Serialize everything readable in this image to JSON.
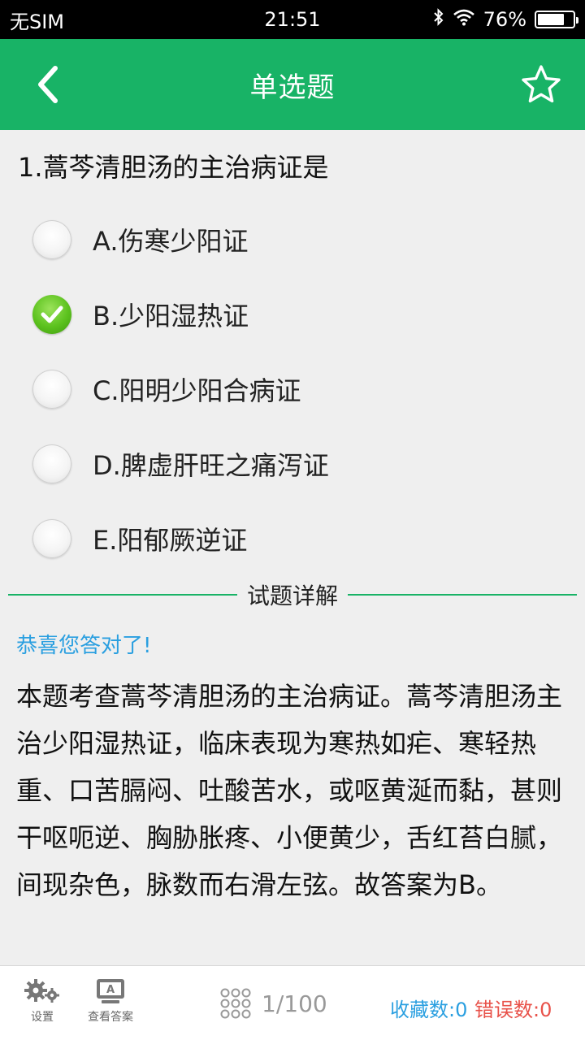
{
  "status": {
    "carrier": "无SIM",
    "time": "21:51",
    "battery_text": "76%",
    "battery_level": 0.76,
    "icons": [
      "bluetooth-icon",
      "wifi-icon",
      "battery-icon"
    ]
  },
  "header": {
    "title": "单选题",
    "back_icon": "chevron-left-icon",
    "favorite_icon": "star-outline-icon",
    "background_color": "#18b366"
  },
  "question": {
    "text": "1.蒿芩清胆汤的主治病证是",
    "options": [
      {
        "label": "A.伤寒少阳证",
        "selected": false
      },
      {
        "label": "B.少阳湿热证",
        "selected": true
      },
      {
        "label": "C.阳明少阳合病证",
        "selected": false
      },
      {
        "label": "D.脾虚肝旺之痛泻证",
        "selected": false
      },
      {
        "label": "E.阳郁厥逆证",
        "selected": false
      }
    ]
  },
  "detail": {
    "heading": "试题详解",
    "result": "恭喜您答对了!",
    "result_color": "#2a9fe0",
    "explanation": "本题考查蒿芩清胆汤的主治病证。蒿芩清胆汤主治少阳湿热证，临床表现为寒热如疟、寒轻热重、口苦膈闷、吐酸苦水，或呕黄涎而黏，甚则干呕呃逆、胸胁胀疼、小便黄少，舌红苔白腻，间现杂色，脉数而右滑左弦。故答案为B。"
  },
  "bottom": {
    "settings_label": "设置",
    "answer_label": "查看答案",
    "progress": "1/100",
    "favorites": "收藏数:0",
    "errors": "错误数:0",
    "favorites_color": "#2a9fe0",
    "errors_color": "#e8524a"
  }
}
